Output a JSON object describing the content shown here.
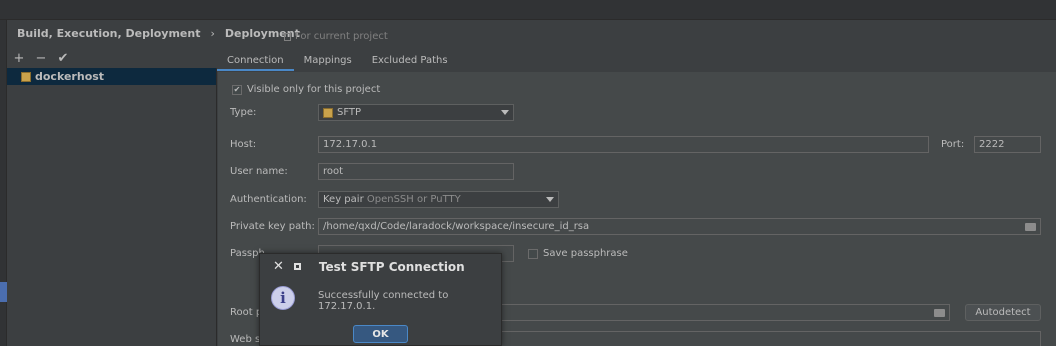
{
  "breadcrumb": {
    "parent": "Build, Execution, Deployment",
    "separator": "›",
    "current": "Deployment"
  },
  "for_current_project": "For current project",
  "toolbar": {
    "add": "+",
    "remove": "−",
    "apply": "✔"
  },
  "tree": {
    "items": [
      {
        "label": "dockerhost",
        "icon": "server-icon"
      }
    ]
  },
  "tabs": [
    {
      "label": "Connection",
      "active": true
    },
    {
      "label": "Mappings",
      "active": false
    },
    {
      "label": "Excluded Paths",
      "active": false
    }
  ],
  "form": {
    "visible_only_label": "Visible only for this project",
    "visible_only_checked": true,
    "type_label": "Type:",
    "type_value": "SFTP",
    "host_label": "Host:",
    "host_value": "172.17.0.1",
    "port_label": "Port:",
    "port_value": "2222",
    "username_label": "User name:",
    "username_value": "root",
    "auth_label": "Authentication:",
    "auth_value_main": "Key pair",
    "auth_value_sub": "OpenSSH or PuTTY",
    "key_path_label": "Private key path:",
    "key_path_value": "/home/qxd/Code/laradock/workspace/insecure_id_rsa",
    "passphrase_label": "Passph",
    "save_passphrase_label": "Save passphrase",
    "root_path_label": "Root p",
    "autodetect_label": "Autodetect",
    "web_server_label": "Web se"
  },
  "dialog": {
    "title": "Test SFTP Connection",
    "close_glyph": "✕",
    "message": "Successfully connected to 172.17.0.1.",
    "ok_label": "OK",
    "info_glyph": "i"
  },
  "colors": {
    "accent": "#4a88c7",
    "background": "#3c3f41",
    "selection": "#0d293e"
  }
}
